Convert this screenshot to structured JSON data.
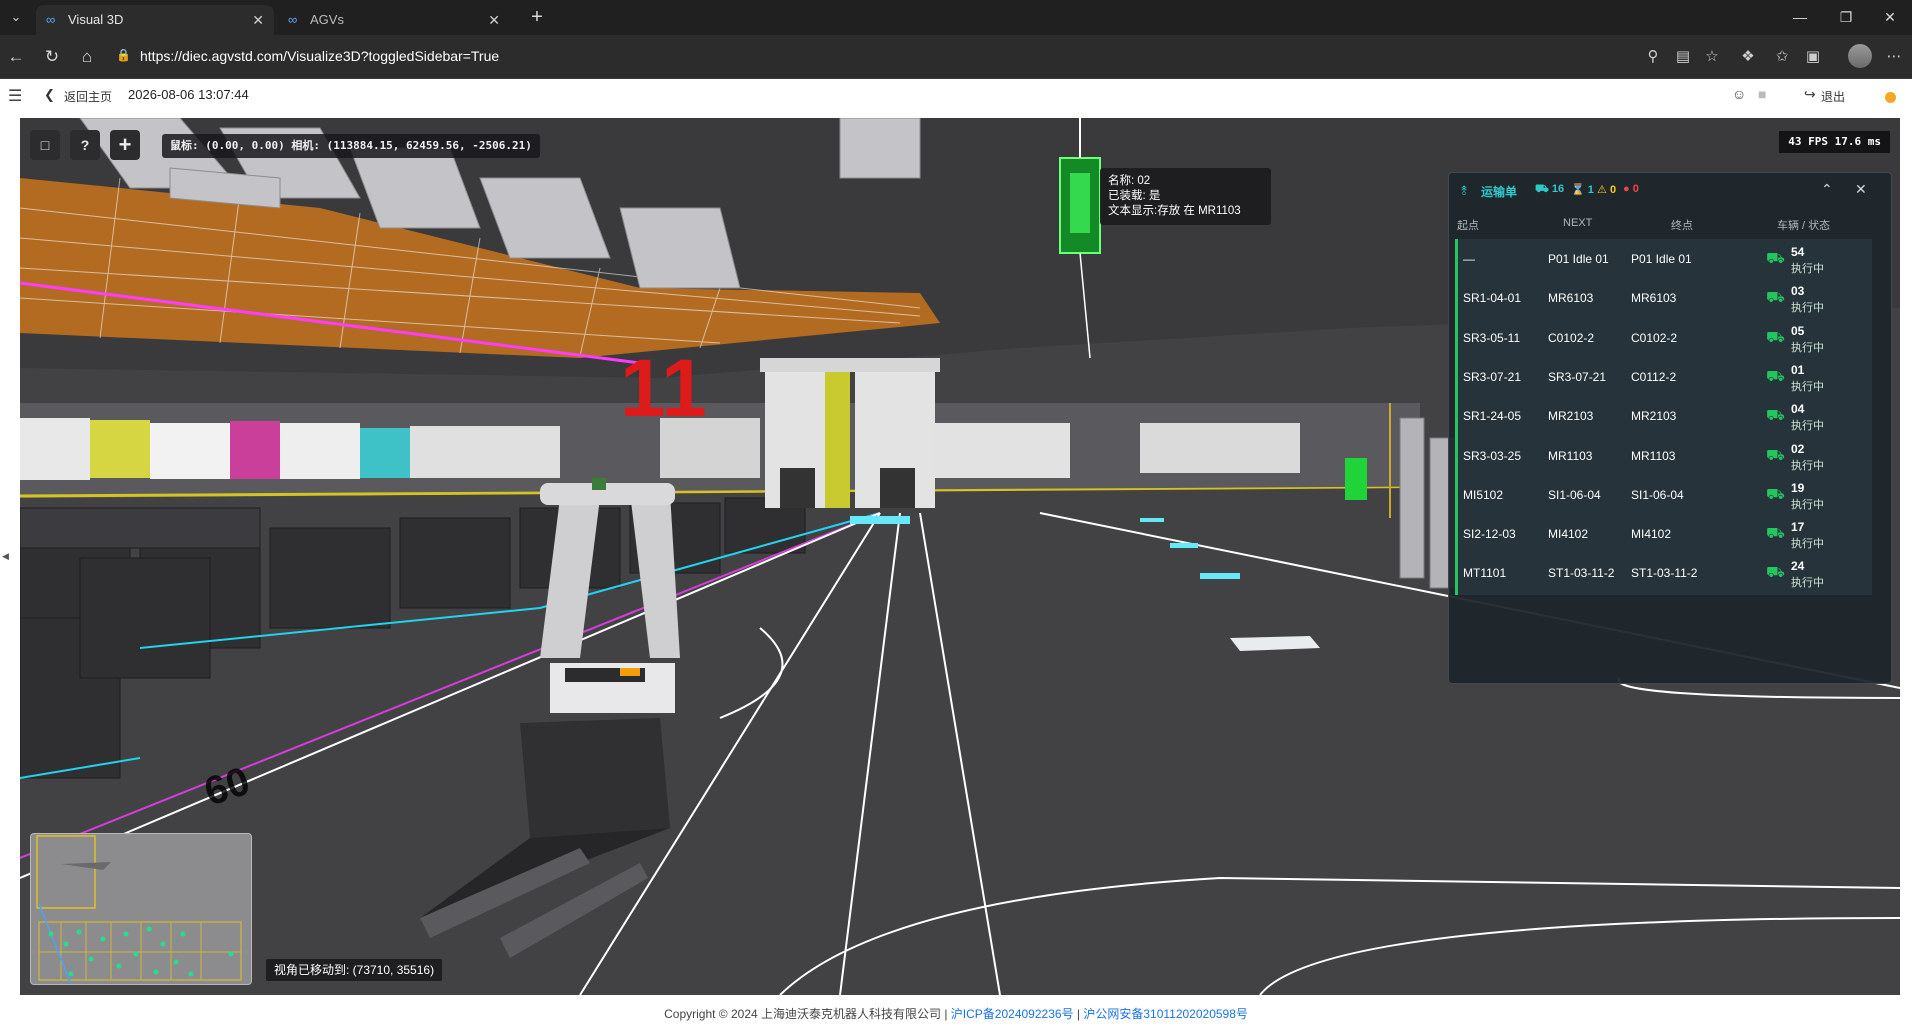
{
  "browser": {
    "tabs": [
      {
        "title": "Visual 3D",
        "active": true
      },
      {
        "title": "AGVs",
        "active": false
      }
    ],
    "url": "https://diec.agvstd.com/Visualize3D?toggledSidebar=True"
  },
  "header": {
    "back_label": "返回主页",
    "datetime": "2026-08-06 13:07:44",
    "logout_label": "退出"
  },
  "viewport": {
    "coords_text": "鼠标: (0.00, 0.00)  相机: (113884.15, 62459.56, -2506.21)",
    "fps_text": "43 FPS 17.6 ms",
    "scene_label": "11",
    "tooltip": {
      "name_line": "名称: 02",
      "loaded_line": "已装载: 是",
      "text_line": "文本显示:存放 在 MR1103"
    },
    "move_hint": "视角已移动到: (73710, 35516)"
  },
  "orders_panel": {
    "title": "运输单",
    "stats": {
      "vehicles": "16",
      "waiting": "1",
      "warnings": "0",
      "errors": "0"
    },
    "columns": [
      "起点",
      "NEXT",
      "终点",
      "车辆 / 状态"
    ],
    "rows": [
      {
        "start": "—",
        "next": "P01 Idle 01",
        "end": "P01 Idle 01",
        "vehicle": "54",
        "status": "执行中"
      },
      {
        "start": "SR1-04-01",
        "next": "MR6103",
        "end": "MR6103",
        "vehicle": "03",
        "status": "执行中"
      },
      {
        "start": "SR3-05-11",
        "next": "C0102-2",
        "end": "C0102-2",
        "vehicle": "05",
        "status": "执行中"
      },
      {
        "start": "SR3-07-21",
        "next": "SR3-07-21",
        "end": "C0112-2",
        "vehicle": "01",
        "status": "执行中"
      },
      {
        "start": "SR1-24-05",
        "next": "MR2103",
        "end": "MR2103",
        "vehicle": "04",
        "status": "执行中"
      },
      {
        "start": "SR3-03-25",
        "next": "MR1103",
        "end": "MR1103",
        "vehicle": "02",
        "status": "执行中"
      },
      {
        "start": "MI5102",
        "next": "SI1-06-04",
        "end": "SI1-06-04",
        "vehicle": "19",
        "status": "执行中"
      },
      {
        "start": "SI2-12-03",
        "next": "MI4102",
        "end": "MI4102",
        "vehicle": "17",
        "status": "执行中"
      },
      {
        "start": "MT1101",
        "next": "ST1-03-11-2",
        "end": "ST1-03-11-2",
        "vehicle": "24",
        "status": "执行中"
      }
    ]
  },
  "footer": {
    "copyright": "Copyright © 2024 上海迪沃泰克机器人科技有限公司 | ",
    "icp": "沪ICP备2024092236号",
    "sep": " | ",
    "police": "沪公网安备31011202020598号"
  },
  "colors": {
    "accent_teal": "#2ec9c9",
    "ok_green": "#22c55e",
    "warn_yellow": "#facc15",
    "error_red": "#ef4444",
    "scene_floor": "#424245"
  },
  "icons": [
    "tab-menu-icon",
    "edge-icon",
    "close-icon",
    "plus-icon",
    "back-arrow-icon",
    "refresh-icon",
    "home-icon",
    "lock-icon",
    "key-icon",
    "reader-icon",
    "star-icon",
    "extensions-icon",
    "favorites-icon",
    "collections-icon",
    "more-icon",
    "hamburger-icon",
    "user-icon",
    "logout-icon",
    "car-icon",
    "hourglass-icon",
    "warning-icon",
    "error-icon",
    "collapse-icon"
  ]
}
